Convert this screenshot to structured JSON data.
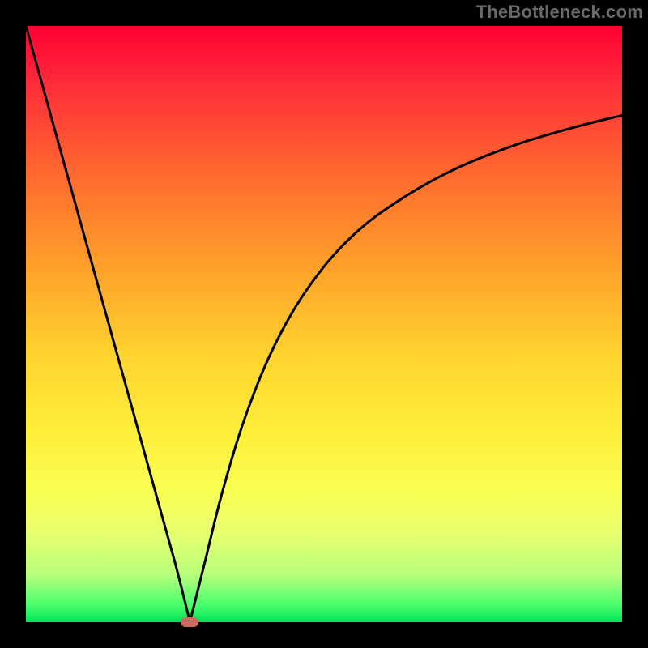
{
  "watermark": "TheBottleneck.com",
  "chart_data": {
    "type": "line",
    "title": "",
    "xlabel": "",
    "ylabel": "",
    "xlim": [
      0,
      100
    ],
    "ylim": [
      0,
      100
    ],
    "series": [
      {
        "name": "left-branch",
        "x": [
          0,
          5,
          10,
          15,
          20,
          25,
          27.5
        ],
        "values": [
          100,
          82,
          64,
          46,
          28,
          10,
          0
        ]
      },
      {
        "name": "right-branch",
        "x": [
          27.5,
          30,
          33,
          37,
          42,
          48,
          55,
          63,
          72,
          82,
          92,
          100
        ],
        "values": [
          0,
          10,
          22,
          35,
          47,
          57,
          65,
          71,
          76,
          80,
          83,
          85
        ]
      }
    ],
    "annotations": [
      {
        "name": "min-marker",
        "x": 27.5,
        "y": 0,
        "color": "#cf6a62"
      }
    ],
    "background_gradient": {
      "top": "#ff0033",
      "mid": "#ffd22e",
      "bottom": "#00e256"
    }
  }
}
